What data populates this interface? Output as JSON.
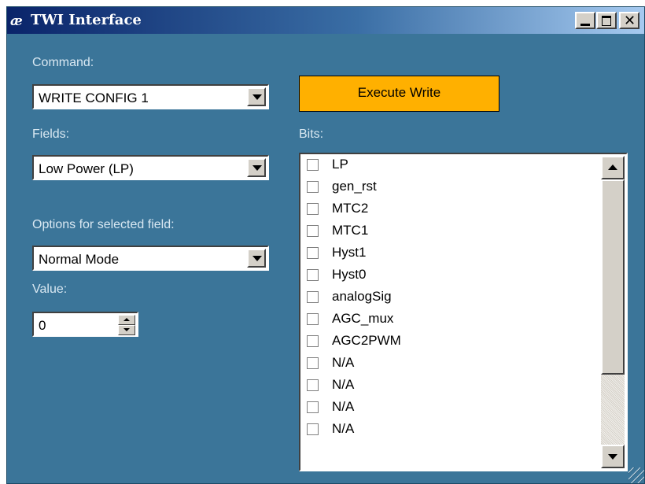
{
  "window": {
    "title": "TWI Interface",
    "icon": "ae-app-icon"
  },
  "command": {
    "label": "Command:",
    "value": "WRITE CONFIG 1"
  },
  "execute_button": {
    "label": "Execute Write",
    "color": "#ffb000"
  },
  "fields": {
    "label": "Fields:",
    "value": "Low Power (LP)"
  },
  "options": {
    "label": "Options for selected field:",
    "value": "Normal Mode"
  },
  "value": {
    "label": "Value:",
    "current": "0"
  },
  "bits": {
    "label": "Bits:",
    "items": [
      "LP",
      "gen_rst",
      "MTC2",
      "MTC1",
      "Hyst1",
      "Hyst0",
      "analogSig",
      "AGC_mux",
      "AGC2PWM",
      "N/A",
      "N/A",
      "N/A",
      "N/A"
    ]
  },
  "colors": {
    "window_background": "#3b7599",
    "label_text": "#d9e8f2"
  }
}
